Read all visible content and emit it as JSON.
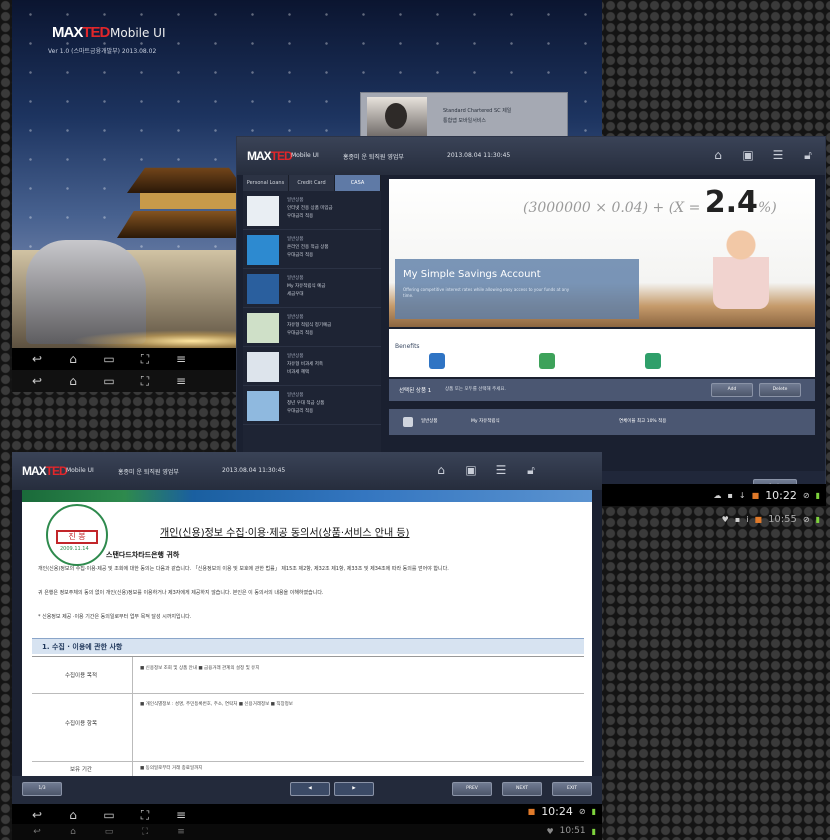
{
  "splash": {
    "logo_max": "MAX",
    "logo_ted": "TED",
    "title": "Mobile UI",
    "subtitle": "Ver 1.0 (스마트금융개발부) 2013.08.02",
    "card_line1": "Standard Chartered SC 제일",
    "card_line2": "통합앱 모바일서비스"
  },
  "home": {
    "logo_max": "MAX",
    "logo_ted": "TED",
    "app": "Mobile UI",
    "user": "홍종미 운 퇴직원 영업부",
    "date": "2013.08.04 11:30:45",
    "tabs": [
      "Personal Loans",
      "Credit Card",
      "CASA"
    ],
    "products": [
      {
        "cat": "일반상품",
        "name": "인터넷 전용 상품 미입금",
        "sub": "우대금리 적용"
      },
      {
        "cat": "일반상품",
        "name": "온라인 전용 적금 상품",
        "sub": "우대금리 적용"
      },
      {
        "cat": "일반상품",
        "name": "My 자유적립식 예금",
        "sub": "세금우대"
      },
      {
        "cat": "일반상품",
        "name": "자유형 적립식 정기예금",
        "sub": "우대금리 적용"
      },
      {
        "cat": "일반상품",
        "name": "자유형 비과세 저축",
        "sub": "비과세 혜택"
      },
      {
        "cat": "일반상품",
        "name": "청년 우대 적금 상품",
        "sub": "우대금리 적용"
      }
    ],
    "banner_formula": "(3000000 × 0.04) + (X = ",
    "banner_rate": "2.4",
    "banner_title": "My Simple Savings Account",
    "banner_desc": "Offering competitive interest rates while allowing easy access to your funds at any time.",
    "benefits_label": "Benefits",
    "action_label": "선택된 상품 1",
    "action_msg": "상품 또는 모두를 선택해 주세요.",
    "add_label": "Add",
    "delete_label": "Delete",
    "row_label1": "일반상품",
    "row_label2": "My 자유적립식",
    "row_label3": "연체이율 최고 10% 적용",
    "apply_label": "Apply",
    "clock": "10:22"
  },
  "doc": {
    "logo_max": "MAX",
    "logo_ted": "TED",
    "app": "Mobile UI",
    "user": "홍종미 운 퇴직원 영업부",
    "date": "2013.08.04 11:30:45",
    "seal_text": "진 봉",
    "seal_date": "2009.11.14",
    "title": "개인(신용)정보 수집·이용·제공 동의서(상품·서비스 안내 등)",
    "bank": "스탠다드차타드은행 귀하",
    "para1": "개인(신용)정보의 수집·이용·제공 및 조회에 대한 동의는 다음과 같습니다. 「신용정보의 이용 및 보호에 관한 법률」 제15조 제2항, 제32조 제1항, 제33조 및 제34조에 따라 동의를 얻어야 합니다.",
    "para2": "귀 은행은 정보주체의 동의 없이 개인(신용)정보를 이용하거나 제3자에게 제공하지 않습니다. 본인은 이 동의서의 내용을 이해하였습니다.",
    "para3": "* 신용정보 제공 ·이용 기간은 동의일로부터 업무 목적 달성 시까지입니다.",
    "section": "1. 수집 · 이용에 관한 사항",
    "rows": [
      {
        "label": "수집이용 목적",
        "text": "■ 신용정보 조회 및 상품 안내  ■ 금융거래 관계의 설정 및 유지"
      },
      {
        "label": "수집이용 항목",
        "text": "■ 개인식별정보 : 성명, 주민등록번호, 주소, 연락처  ■ 신용거래정보  ■ 직장정보"
      },
      {
        "label": "보유 기간",
        "text": "■ 동의일로부터 거래 종료일까지"
      }
    ],
    "page_prev": "◀",
    "page_next": "▶",
    "prev_label": "PREV",
    "next_label": "NEXT",
    "exit_label": "EXIT",
    "page_info": "1/3",
    "clock": "10:24",
    "clock2": "10:55",
    "clock3": "10:51"
  }
}
